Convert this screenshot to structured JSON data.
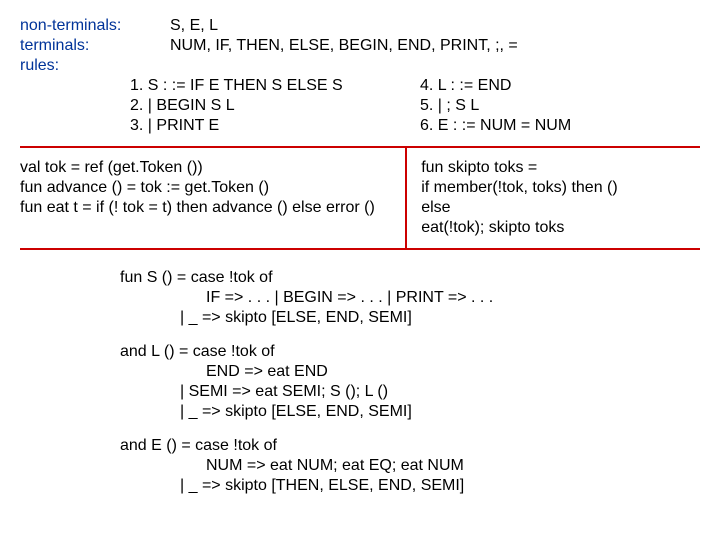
{
  "grammar": {
    "nonterminals_label": "non-terminals:",
    "nonterminals_value": "S, E, L",
    "terminals_label": "terminals:",
    "terminals_value": "NUM, IF, THEN, ELSE, BEGIN, END, PRINT, ;, =",
    "rules_label": "rules:",
    "rules_left": [
      "1.  S : := IF E THEN S ELSE S",
      "2.       | BEGIN S L",
      "3.       | PRINT E"
    ],
    "rules_right": [
      "4.  L : := END",
      "5.       | ; S L",
      "6.  E : := NUM = NUM"
    ]
  },
  "helpers_left": [
    "val tok = ref (get.Token ())",
    "fun advance () = tok := get.Token ()",
    "fun eat t = if (! tok = t) then advance () else error ()"
  ],
  "helpers_right": [
    "fun skipto toks =",
    "    if member(!tok, toks) then ()",
    "    else",
    "      eat(!tok); skipto toks"
  ],
  "funS": {
    "l1": "fun S () = case !tok of",
    "l2": "IF => . . . | BEGIN => . . . | PRINT => . . .",
    "l3": "| _ => skipto [ELSE, END, SEMI]"
  },
  "funL": {
    "l1": "and L () = case !tok of",
    "l2": "END     =>  eat END",
    "l3": "| SEMI    =>  eat SEMI; S (); L ()",
    "l4": "| _          =>  skipto [ELSE, END, SEMI]"
  },
  "funE": {
    "l1": "and E () = case !tok of",
    "l2": "NUM => eat NUM; eat EQ; eat NUM",
    "l3": "| _       => skipto [THEN, ELSE, END, SEMI]"
  }
}
